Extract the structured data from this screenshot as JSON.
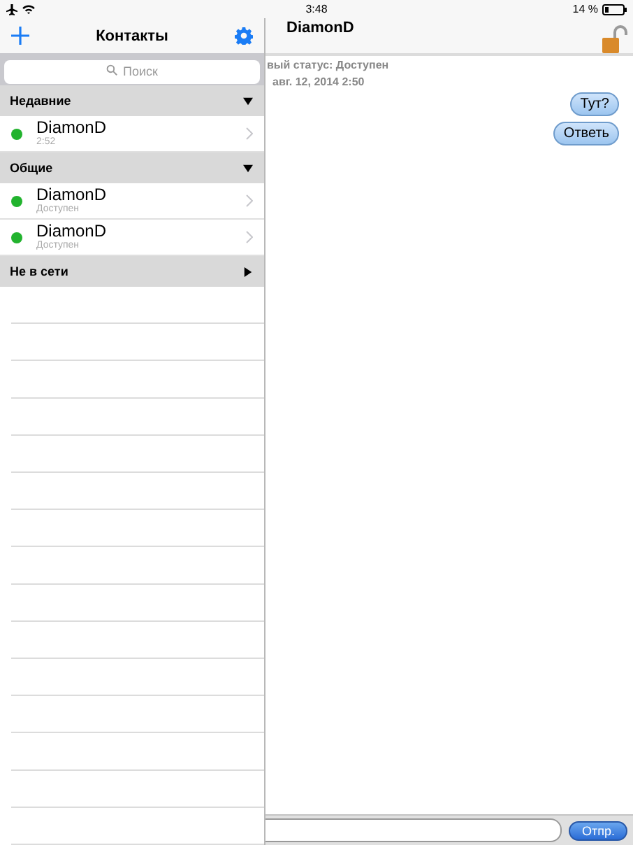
{
  "status_bar": {
    "time": "3:48",
    "battery": "14 %"
  },
  "sidebar": {
    "title": "Контакты",
    "search": {
      "placeholder": "Поиск"
    },
    "groups": [
      {
        "name": "Недавние",
        "expanded": true,
        "contacts": [
          {
            "name": "DiamonD",
            "subtitle": "2:52",
            "color": "#22b32e"
          }
        ]
      },
      {
        "name": "Общие",
        "expanded": true,
        "contacts": [
          {
            "name": "DiamonD",
            "subtitle": "Доступен",
            "color": "#22b32e"
          },
          {
            "name": "DiamonD",
            "subtitle": "Доступен",
            "color": "#22b32e"
          }
        ]
      },
      {
        "name": "Не в сети",
        "expanded": false
      }
    ]
  },
  "chat": {
    "title": "DiamonD",
    "log": [
      "вый статус: Доступен",
      "авг. 12, 2014 2:50"
    ],
    "messages": [
      "Тут?",
      "Ответь"
    ],
    "send_button": "Отпр."
  }
}
